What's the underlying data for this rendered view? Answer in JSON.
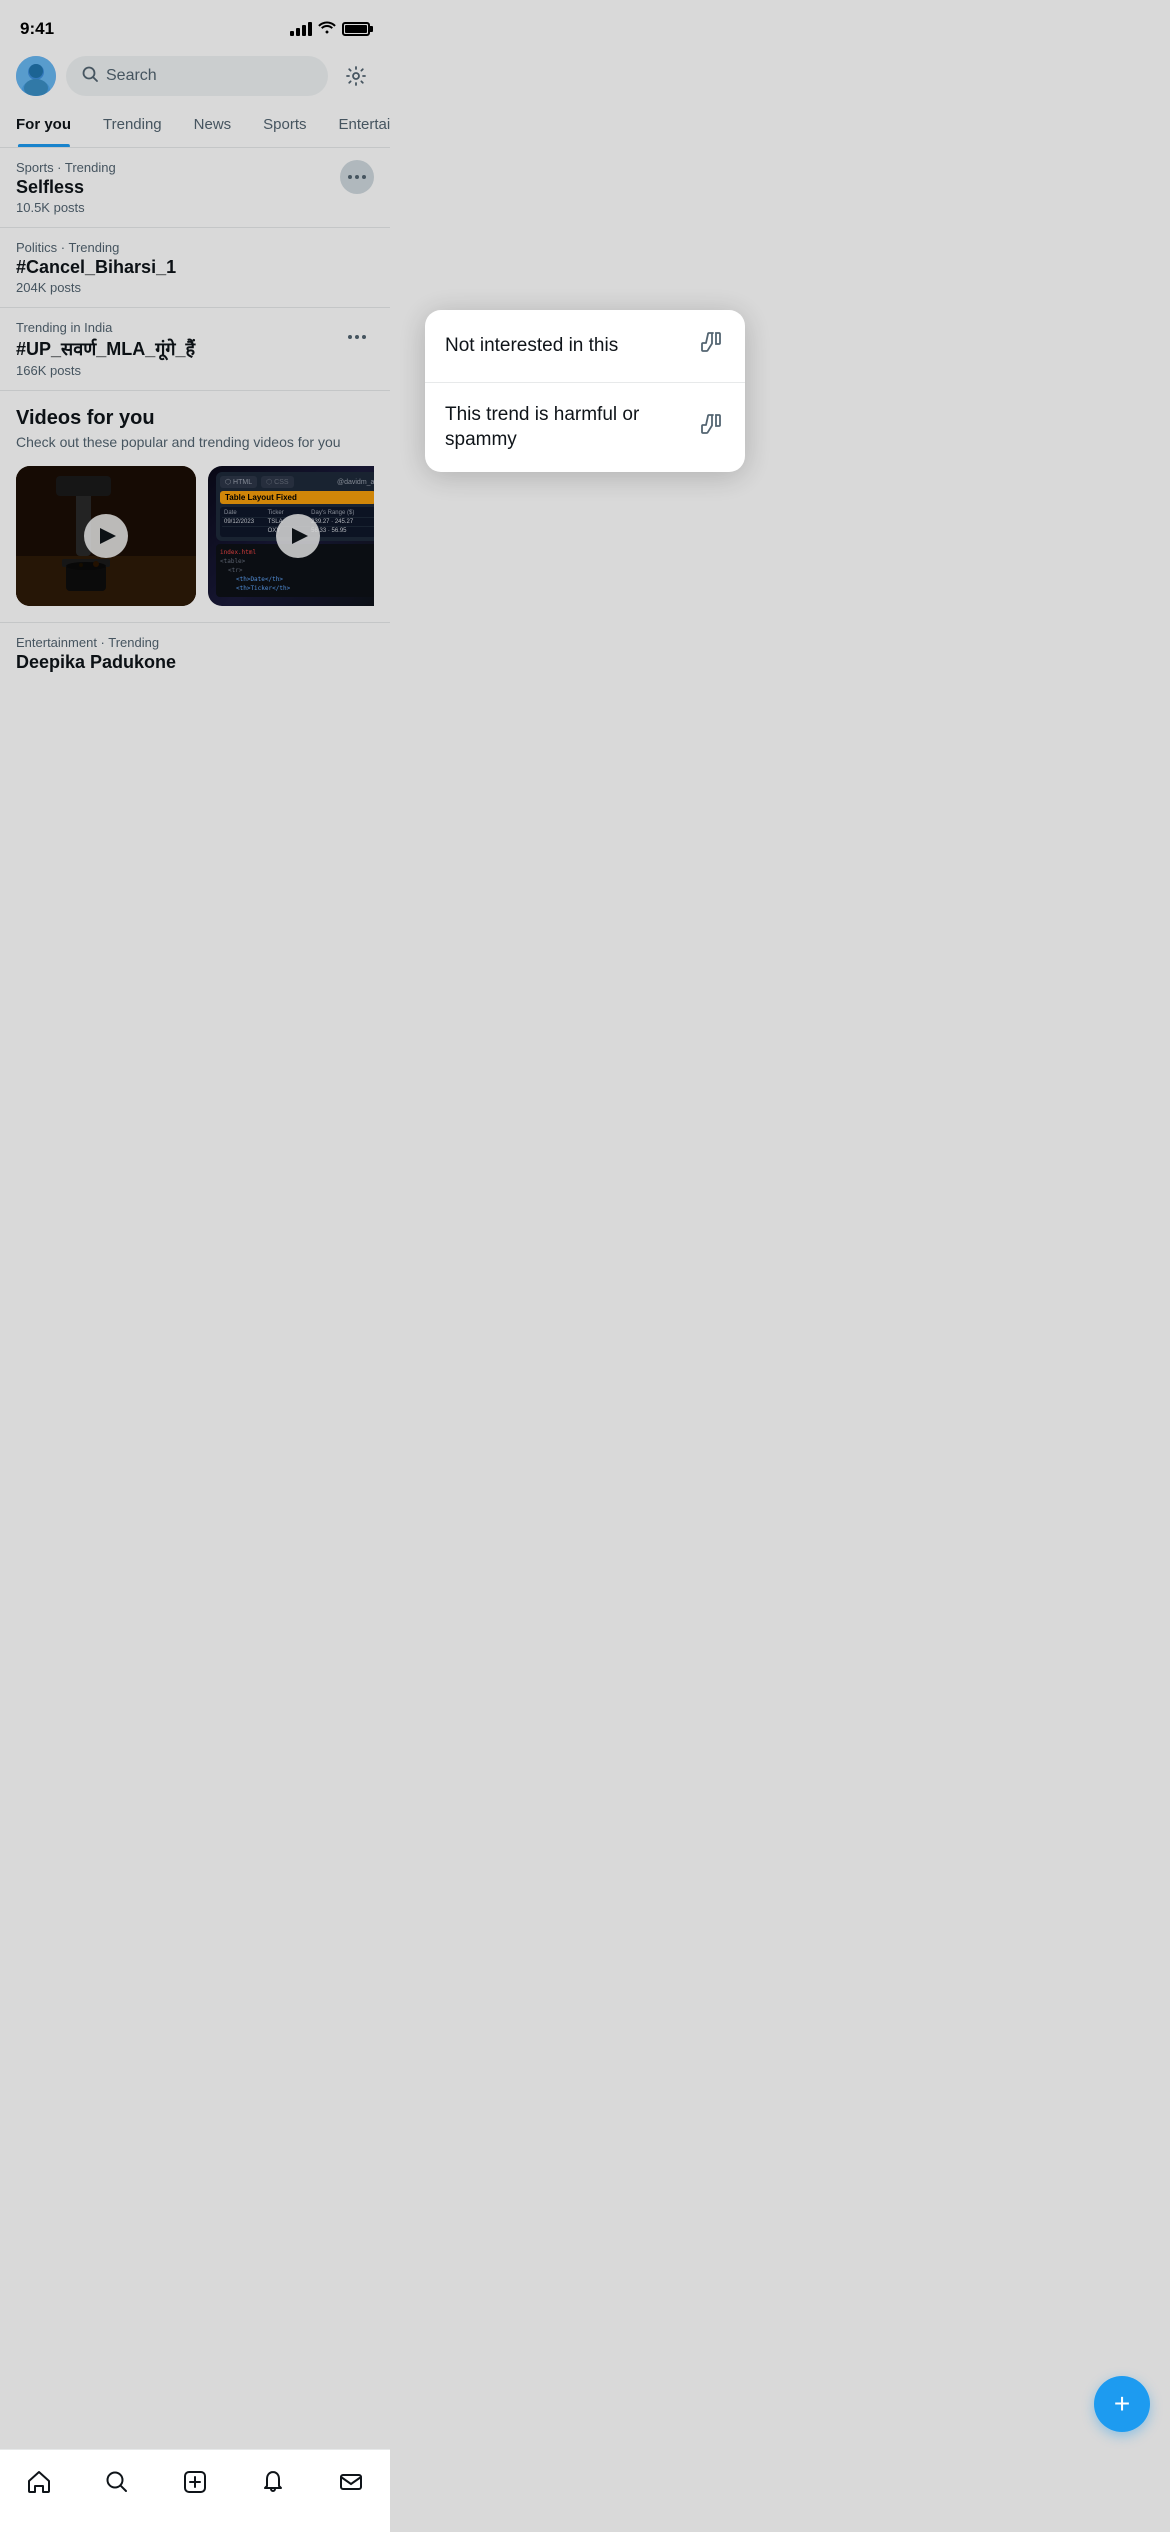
{
  "statusBar": {
    "time": "9:41"
  },
  "header": {
    "searchPlaceholder": "Search"
  },
  "tabs": [
    {
      "label": "For you",
      "active": true
    },
    {
      "label": "Trending",
      "active": false
    },
    {
      "label": "News",
      "active": false
    },
    {
      "label": "Sports",
      "active": false
    },
    {
      "label": "Entertainment",
      "active": false
    }
  ],
  "trending": [
    {
      "meta": "Sports · Trending",
      "title": "Selfless",
      "posts": "10.5K posts",
      "hasMore": true
    },
    {
      "meta": "Politics · Trending",
      "title": "#Cancel_Biharsi_1",
      "posts": "204K posts",
      "hasMore": false
    },
    {
      "meta": "Trending in India",
      "title": "#UP_सवर्ण_MLA_गूंगे_हैं",
      "posts": "166K posts",
      "hasMore": true
    }
  ],
  "contextMenu": {
    "items": [
      {
        "label": "Not interested in this"
      },
      {
        "label": "This trend is harmful or spammy"
      }
    ]
  },
  "videosSection": {
    "title": "Videos for you",
    "subtitle": "Check out these popular and trending videos for you"
  },
  "entertainmentTrending": {
    "meta": "Entertainment · Trending",
    "title": "Deepika Padukone"
  },
  "fab": {
    "label": "+"
  },
  "bottomNav": {
    "items": [
      "home",
      "search",
      "compose",
      "notifications",
      "messages"
    ]
  }
}
